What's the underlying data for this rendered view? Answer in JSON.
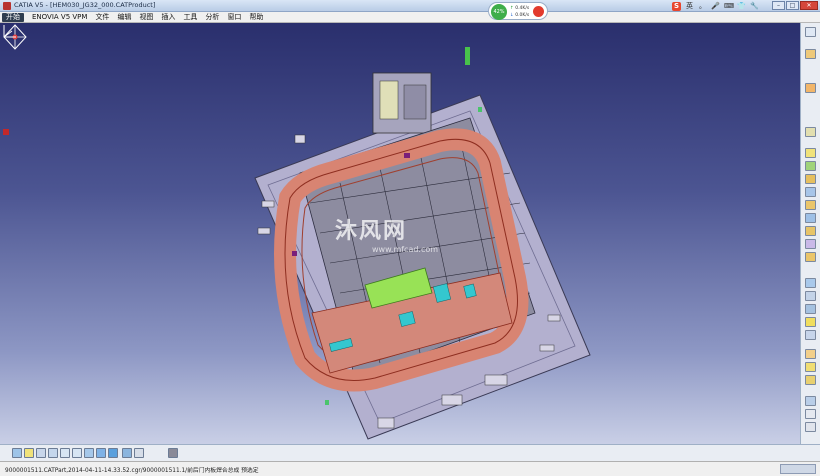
{
  "window": {
    "title": "CATIA V5 - [HEM030_JG32_000.CATProduct]",
    "controls": [
      "minimize",
      "maximize",
      "close"
    ]
  },
  "menu": {
    "start": "开始",
    "items": [
      "ENOVIA V5 VPM",
      "文件",
      "编辑",
      "视图",
      "插入",
      "工具",
      "分析",
      "窗口",
      "帮助"
    ]
  },
  "perf_widget": {
    "percent": "42%",
    "upload": "0.4K/s",
    "download": "0.0K/s"
  },
  "tray": {
    "ime_label": "S",
    "ime_items": [
      "英",
      "。",
      "🎤",
      "⌨",
      "👕",
      "🔧"
    ]
  },
  "viewport": {
    "watermark": "沐风网",
    "watermark_url": "www.mfcad.com",
    "colors": {
      "fixture_plate": "#b5b2cf",
      "frame_pink": "#d98a78",
      "frame_edge": "#a03a2a",
      "cyan_parts": "#3cc8c8",
      "green_part": "#9be35a",
      "metal": "#8a8aa0"
    }
  },
  "right_toolbar": {
    "icons": [
      "sketch-icon",
      "part-icon",
      "sheet-icon",
      "product-icon",
      "new-component-icon",
      "existing-component-icon",
      "replace-component-icon",
      "graph-tree-icon",
      "renumber-icon",
      "constraint-icon",
      "fix-icon",
      "coincidence-icon",
      "contact-icon",
      "offset-icon",
      "angle-icon",
      "update-icon",
      "snap-icon",
      "explode-icon",
      "clash-icon",
      "section-icon",
      "measure-icon",
      "catalog-icon",
      "bom-icon",
      "publication-icon"
    ]
  },
  "bottom_toolbar": {
    "icons": [
      "fly-mode-icon",
      "fit-all-icon",
      "pan-icon",
      "rotate-icon",
      "zoom-in-icon",
      "zoom-out-icon",
      "normal-view-icon",
      "iso-view-icon",
      "shading-icon",
      "hide-show-icon",
      "swap-space-icon",
      "material-icon"
    ]
  },
  "status": {
    "text": "9000001511.CATPart,2014-04-11-14.33.52.cgr/9000001511.1/前后门内板焊合总成 预选定"
  }
}
